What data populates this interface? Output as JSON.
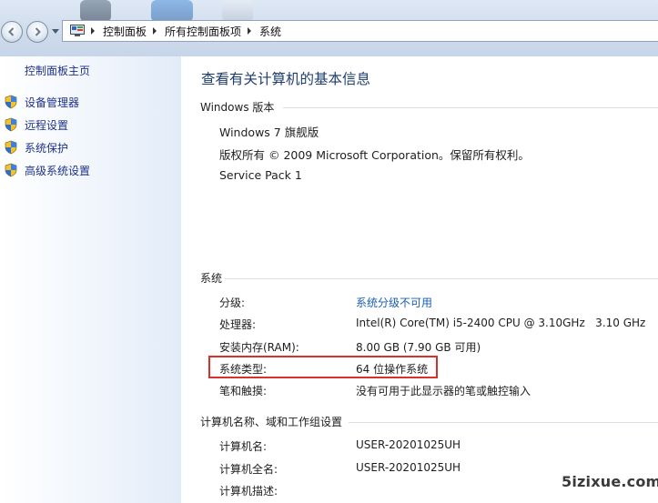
{
  "breadcrumb": {
    "items": [
      "控制面板",
      "所有控制面板项",
      "系统"
    ]
  },
  "sidebar": {
    "home_label": "控制面板主页",
    "items": [
      {
        "label": "设备管理器",
        "icon": "shield-icon"
      },
      {
        "label": "远程设置",
        "icon": "shield-icon"
      },
      {
        "label": "系统保护",
        "icon": "shield-icon"
      },
      {
        "label": "高级系统设置",
        "icon": "shield-icon"
      }
    ]
  },
  "main": {
    "title": "查看有关计算机的基本信息",
    "edition": {
      "heading": "Windows 版本",
      "name": "Windows 7 旗舰版",
      "copyright": "版权所有 © 2009 Microsoft Corporation。保留所有权利。",
      "service_pack": "Service Pack 1"
    },
    "system": {
      "heading": "系统",
      "rows": [
        {
          "key": "分级:",
          "value": "系统分级不可用"
        },
        {
          "key": "处理器:",
          "value": "Intel(R) Core(TM) i5-2400 CPU @ 3.10GHz   3.10 GHz"
        },
        {
          "key": "安装内存(RAM):",
          "value": "8.00 GB (7.90 GB 可用)"
        },
        {
          "key": "系统类型:",
          "value": "64 位操作系统"
        },
        {
          "key": "笔和触摸:",
          "value": "没有可用于此显示器的笔或触控输入"
        }
      ]
    },
    "computer": {
      "heading": "计算机名称、域和工作组设置",
      "rows": [
        {
          "key": "计算机名:",
          "value": "USER-20201025UH"
        },
        {
          "key": "计算机全名:",
          "value": "USER-20201025UH"
        },
        {
          "key": "计算机描述:",
          "value": ""
        }
      ]
    }
  },
  "watermark": "5izixue.com",
  "colors": {
    "link": "#1a5fb4",
    "title": "#1e3e6e",
    "highlight_border": "#d9302c"
  }
}
